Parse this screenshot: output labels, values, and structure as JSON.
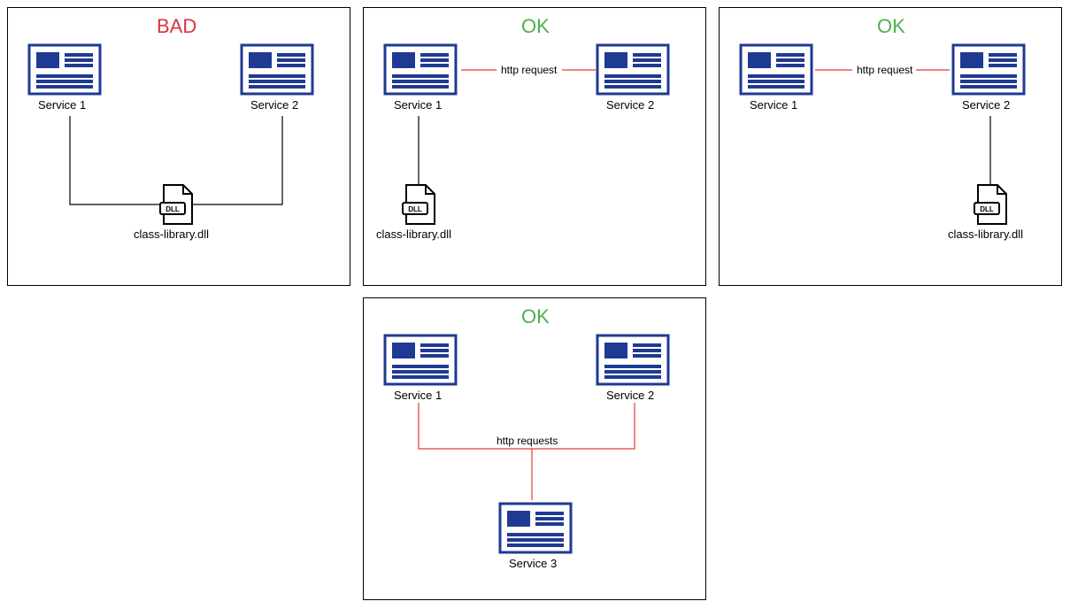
{
  "panels": {
    "bad": {
      "title": "BAD",
      "service1": "Service 1",
      "service2": "Service 2",
      "dll": "class-library.dll"
    },
    "ok1": {
      "title": "OK",
      "service1": "Service 1",
      "service2": "Service 2",
      "dll": "class-library.dll",
      "http": "http request"
    },
    "ok2": {
      "title": "OK",
      "service1": "Service 1",
      "service2": "Service 2",
      "dll": "class-library.dll",
      "http": "http request"
    },
    "ok3": {
      "title": "OK",
      "service1": "Service 1",
      "service2": "Service 2",
      "service3": "Service 3",
      "http": "http requests"
    }
  }
}
